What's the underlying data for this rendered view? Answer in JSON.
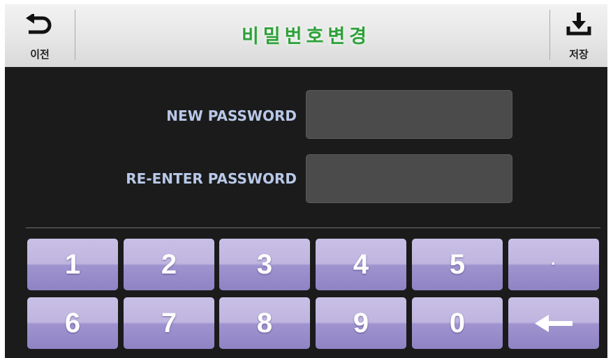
{
  "header": {
    "title": "비밀번호변경",
    "back_label": "이전",
    "save_label": "저장"
  },
  "form": {
    "new_password_label": "NEW PASSWORD",
    "new_password_value": "",
    "reenter_password_label": "RE-ENTER PASSWORD",
    "reenter_password_value": ""
  },
  "keypad": {
    "row1": [
      "1",
      "2",
      "3",
      "4",
      "5",
      "·"
    ],
    "row2": [
      "6",
      "7",
      "8",
      "9",
      "0",
      "←"
    ]
  },
  "icons": {
    "back": "undo-arrow-icon",
    "save": "download-icon",
    "backspace": "left-arrow-icon"
  },
  "colors": {
    "title": "#2ea03a",
    "panel": "#1b1b1b",
    "key": "#a89ed6",
    "field": "#4b4b4b",
    "label": "#b8c8e8"
  }
}
